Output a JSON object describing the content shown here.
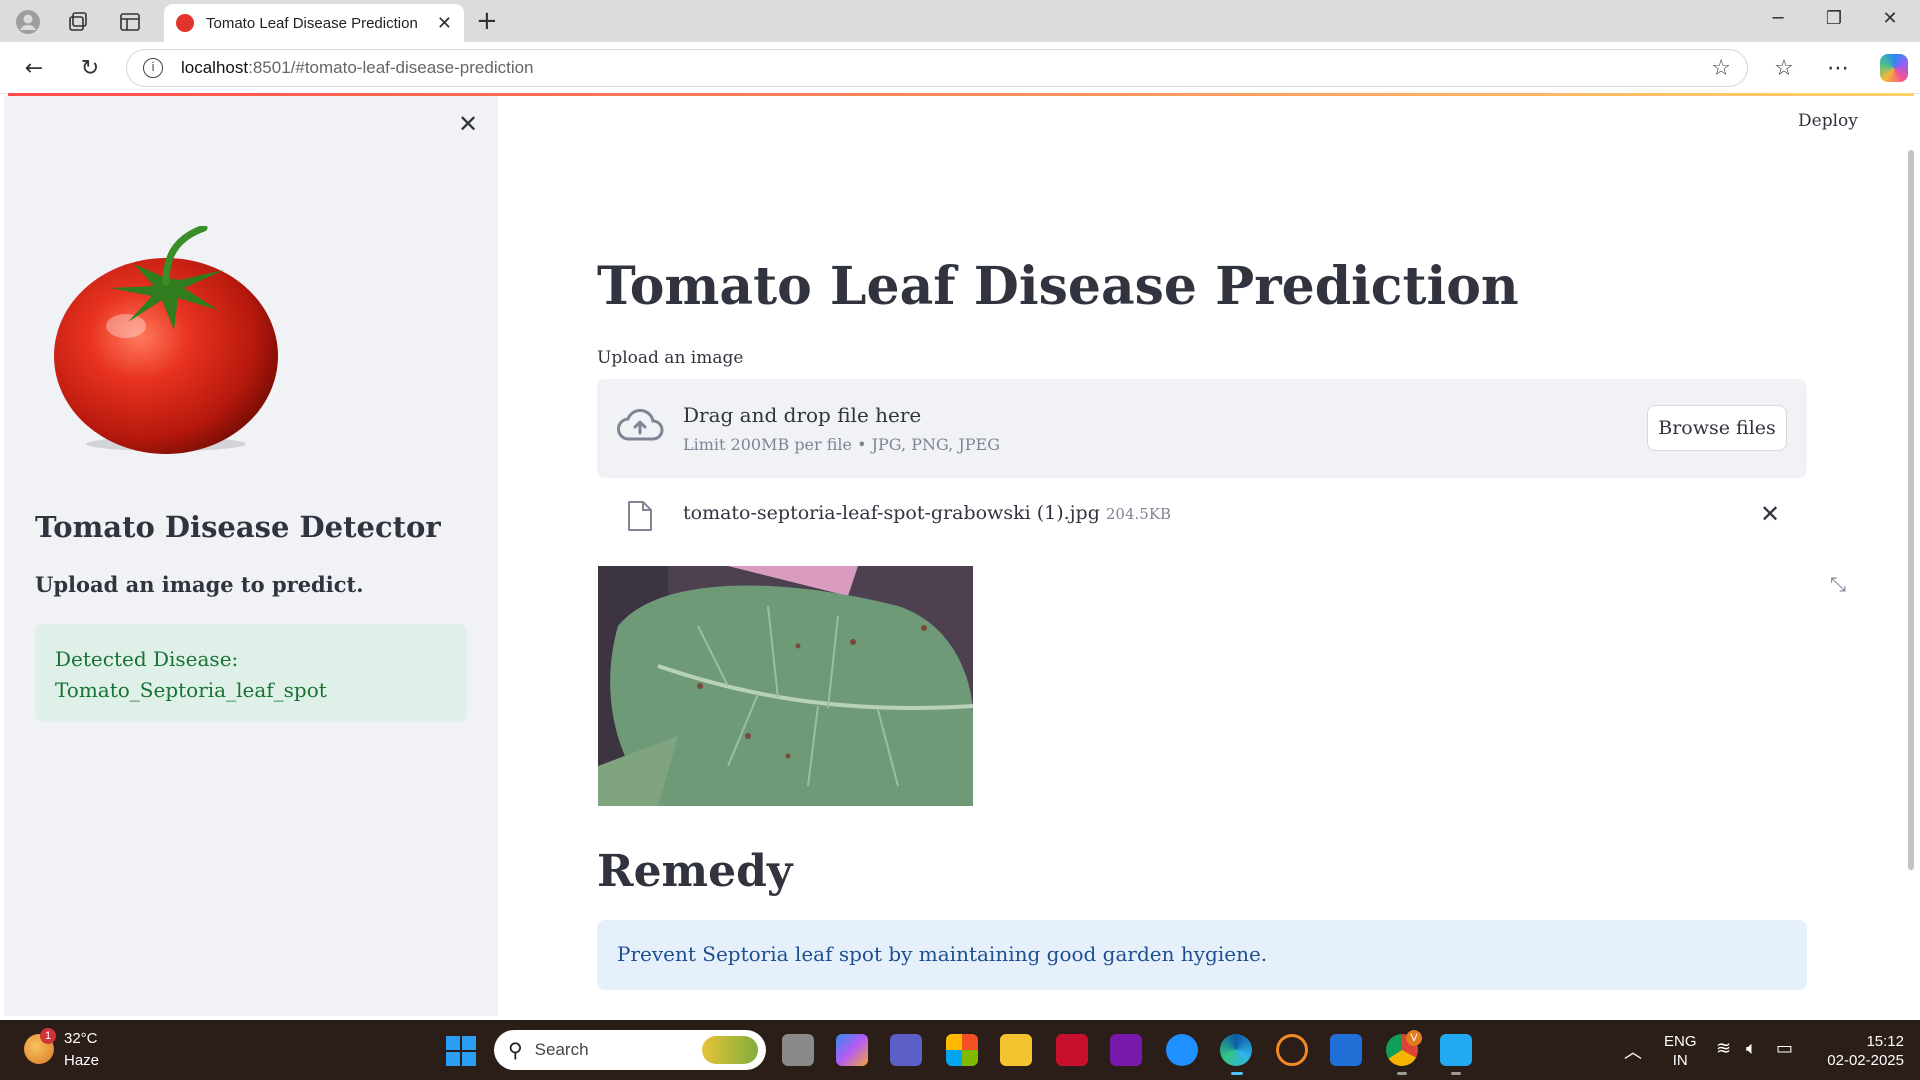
{
  "browser": {
    "tab_title": "Tomato Leaf Disease Prediction",
    "url_host": "localhost",
    "url_rest": ":8501/#tomato-leaf-disease-prediction"
  },
  "sidebar": {
    "title": "Tomato Disease Detector",
    "subtitle": "Upload an image to predict.",
    "result_line1": "Detected Disease:",
    "result_line2": "Tomato_Septoria_leaf_spot"
  },
  "main": {
    "deploy_label": "Deploy",
    "heading": "Tomato Leaf Disease Prediction",
    "upload_label": "Upload an image",
    "dropzone_text": "Drag and drop file here",
    "dropzone_limit": "Limit 200MB per file • JPG, PNG, JPEG",
    "browse_label": "Browse files",
    "file_name": "tomato-septoria-leaf-spot-grabowski (1).jpg",
    "file_size": "204.5KB",
    "remedy_heading": "Remedy",
    "remedy_text": "Prevent Septoria leaf spot by maintaining good garden hygiene."
  },
  "taskbar": {
    "weather_badge": "1",
    "temperature": "32°C",
    "condition": "Haze",
    "search_placeholder": "Search",
    "lang_line1": "ENG",
    "lang_line2": "IN",
    "time": "15:12",
    "date": "02-02-2025",
    "chrome_badge": "V"
  },
  "colors": {
    "accent": "#ff4b4b",
    "success_bg": "#dff0e8",
    "success_text": "#177233",
    "info_bg": "#e6f0fb",
    "info_text": "#1d4f91"
  }
}
